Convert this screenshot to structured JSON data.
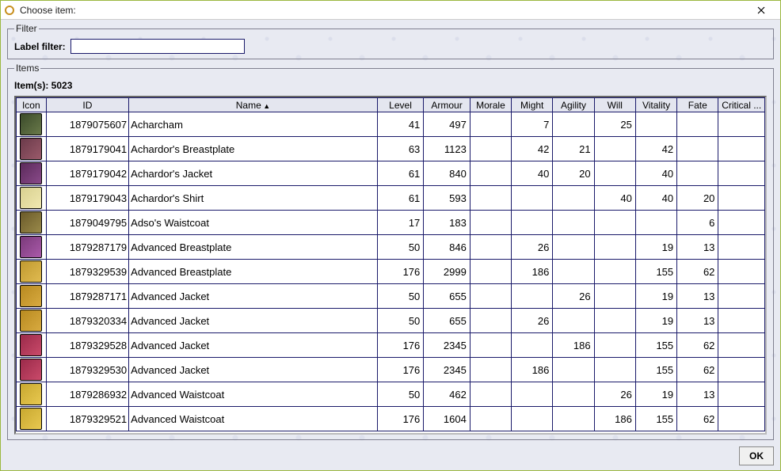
{
  "window": {
    "title": "Choose item:"
  },
  "filter": {
    "legend": "Filter",
    "label": "Label filter:",
    "value": ""
  },
  "items": {
    "legend": "Items",
    "count_label": "Item(s): 5023"
  },
  "columns": {
    "icon": "Icon",
    "id": "ID",
    "name": "Name",
    "level": "Level",
    "armour": "Armour",
    "morale": "Morale",
    "might": "Might",
    "agility": "Agility",
    "will": "Will",
    "vitality": "Vitality",
    "fate": "Fate",
    "critical": "Critical ..."
  },
  "sorted_on": "name",
  "col_widths": {
    "icon": 36,
    "id": 100,
    "name": 300,
    "level": 56,
    "armour": 56,
    "morale": 50,
    "might": 50,
    "agility": 50,
    "will": 50,
    "vitality": 50,
    "fate": 50,
    "critical": 56
  },
  "rows": [
    {
      "icon_bg": "linear-gradient(135deg,#3a4a2a,#6a7a4a)",
      "id": "1879075607",
      "name": "Acharcham",
      "level": "41",
      "armour": "497",
      "morale": "",
      "might": "7",
      "agility": "",
      "will": "25",
      "vitality": "",
      "fate": "",
      "critical": ""
    },
    {
      "icon_bg": "linear-gradient(135deg,#6a3a4a,#9a5a6a)",
      "id": "1879179041",
      "name": "Achardor's Breastplate",
      "level": "63",
      "armour": "1123",
      "morale": "",
      "might": "42",
      "agility": "21",
      "will": "",
      "vitality": "42",
      "fate": "",
      "critical": ""
    },
    {
      "icon_bg": "linear-gradient(135deg,#5a2a5a,#8a4a8a)",
      "id": "1879179042",
      "name": "Achardor's Jacket",
      "level": "61",
      "armour": "840",
      "morale": "",
      "might": "40",
      "agility": "20",
      "will": "",
      "vitality": "40",
      "fate": "",
      "critical": ""
    },
    {
      "icon_bg": "linear-gradient(135deg,#d8d090,#f0e8b0)",
      "id": "1879179043",
      "name": "Achardor's Shirt",
      "level": "61",
      "armour": "593",
      "morale": "",
      "might": "",
      "agility": "",
      "will": "40",
      "vitality": "40",
      "fate": "20",
      "critical": ""
    },
    {
      "icon_bg": "linear-gradient(135deg,#6a5a2a,#9a8a4a)",
      "id": "1879049795",
      "name": "Adso's Waistcoat",
      "level": "17",
      "armour": "183",
      "morale": "",
      "might": "",
      "agility": "",
      "will": "",
      "vitality": "",
      "fate": "6",
      "critical": ""
    },
    {
      "icon_bg": "linear-gradient(135deg,#7a3a7a,#aa5aaa)",
      "id": "1879287179",
      "name": "Advanced Breastplate",
      "level": "50",
      "armour": "846",
      "morale": "",
      "might": "26",
      "agility": "",
      "will": "",
      "vitality": "19",
      "fate": "13",
      "critical": ""
    },
    {
      "icon_bg": "linear-gradient(135deg,#c09a30,#e0ba50)",
      "id": "1879329539",
      "name": "Advanced Breastplate",
      "level": "176",
      "armour": "2999",
      "morale": "",
      "might": "186",
      "agility": "",
      "will": "",
      "vitality": "155",
      "fate": "62",
      "critical": ""
    },
    {
      "icon_bg": "linear-gradient(135deg,#b88a20,#d8aa40)",
      "id": "1879287171",
      "name": "Advanced Jacket",
      "level": "50",
      "armour": "655",
      "morale": "",
      "might": "",
      "agility": "26",
      "will": "",
      "vitality": "19",
      "fate": "13",
      "critical": ""
    },
    {
      "icon_bg": "linear-gradient(135deg,#b88a20,#d8aa40)",
      "id": "1879320334",
      "name": "Advanced Jacket",
      "level": "50",
      "armour": "655",
      "morale": "",
      "might": "26",
      "agility": "",
      "will": "",
      "vitality": "19",
      "fate": "13",
      "critical": ""
    },
    {
      "icon_bg": "linear-gradient(135deg,#9a2a4a,#ca4a6a)",
      "id": "1879329528",
      "name": "Advanced Jacket",
      "level": "176",
      "armour": "2345",
      "morale": "",
      "might": "",
      "agility": "186",
      "will": "",
      "vitality": "155",
      "fate": "62",
      "critical": ""
    },
    {
      "icon_bg": "linear-gradient(135deg,#9a2a4a,#ca4a6a)",
      "id": "1879329530",
      "name": "Advanced Jacket",
      "level": "176",
      "armour": "2345",
      "morale": "",
      "might": "186",
      "agility": "",
      "will": "",
      "vitality": "155",
      "fate": "62",
      "critical": ""
    },
    {
      "icon_bg": "linear-gradient(135deg,#c8a830,#e8c850)",
      "id": "1879286932",
      "name": "Advanced Waistcoat",
      "level": "50",
      "armour": "462",
      "morale": "",
      "might": "",
      "agility": "",
      "will": "26",
      "vitality": "19",
      "fate": "13",
      "critical": ""
    },
    {
      "icon_bg": "linear-gradient(135deg,#c8a830,#e8c850)",
      "id": "1879329521",
      "name": "Advanced Waistcoat",
      "level": "176",
      "armour": "1604",
      "morale": "",
      "might": "",
      "agility": "",
      "will": "186",
      "vitality": "155",
      "fate": "62",
      "critical": ""
    }
  ],
  "footer": {
    "ok": "OK"
  }
}
